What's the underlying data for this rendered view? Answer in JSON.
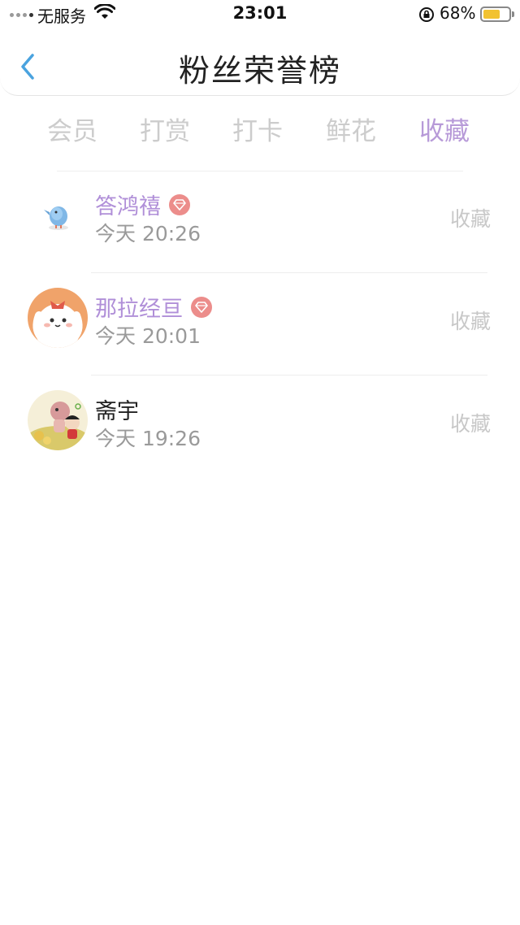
{
  "status_bar": {
    "carrier": "无服务",
    "time": "23:01",
    "battery_percent": "68%",
    "battery_level": 0.68,
    "icons": [
      "signal-icon",
      "wifi-icon",
      "rotation-lock-icon",
      "battery-icon"
    ]
  },
  "nav": {
    "back_icon": "chevron-left-icon",
    "title": "粉丝荣誉榜"
  },
  "tabs": [
    {
      "label": "会员",
      "active": false
    },
    {
      "label": "打赏",
      "active": false
    },
    {
      "label": "打卡",
      "active": false
    },
    {
      "label": "鲜花",
      "active": false
    },
    {
      "label": "收藏",
      "active": true
    }
  ],
  "list": [
    {
      "name": "答鸿禧",
      "vip": true,
      "time": "今天 20:26",
      "action": "收藏",
      "avatar": "blue-bird-avatar"
    },
    {
      "name": "那拉经亘",
      "vip": true,
      "time": "今天 20:01",
      "action": "收藏",
      "avatar": "white-bunny-avatar"
    },
    {
      "name": "斋宇",
      "vip": false,
      "time": "今天 19:26",
      "action": "收藏",
      "avatar": "cartoon-kids-avatar"
    }
  ],
  "colors": {
    "accent": "#b79ad8",
    "name_vip": "#b08fd8",
    "tab_inactive": "#cccccc",
    "badge": "#ec8d8b",
    "back_arrow": "#4aa3df"
  }
}
